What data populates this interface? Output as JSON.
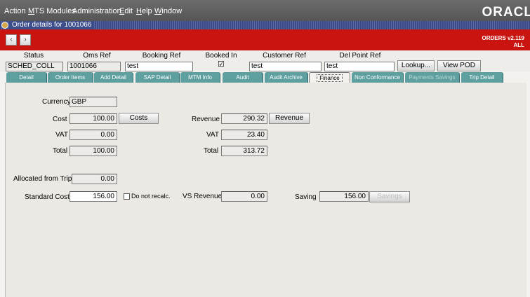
{
  "menu": {
    "items": [
      {
        "label": "Action"
      },
      {
        "label": "MTS Modules"
      },
      {
        "label": "Administration"
      },
      {
        "label": "Edit"
      },
      {
        "label": "Help"
      },
      {
        "label": "Window"
      }
    ],
    "logo": "ORACL"
  },
  "window": {
    "title": "Order details for 1001066"
  },
  "header": {
    "prev_icon": "‹",
    "next_icon": "›",
    "version_line1": "ORDERS v2.119",
    "version_line2": "ALL",
    "status": {
      "label": "Status",
      "value": "SCHED_COLL"
    },
    "oms_ref": {
      "label": "Oms Ref",
      "value": "1001066"
    },
    "booking_ref": {
      "label": "Booking Ref",
      "value": "test"
    },
    "booked_in": {
      "label": "Booked In",
      "checked": true
    },
    "customer_ref": {
      "label": "Customer Ref",
      "value": "test"
    },
    "del_point_ref": {
      "label": "Del Point Ref",
      "value": "test"
    },
    "lookup_label": "Lookup...",
    "view_pod_label": "View POD"
  },
  "tabs": [
    {
      "label": "Detail"
    },
    {
      "label": "Order Items"
    },
    {
      "label": "Add Detail"
    },
    {
      "label": "SAP Detail"
    },
    {
      "label": "MTM Info"
    },
    {
      "label": "Audit"
    },
    {
      "label": "Audit Archive"
    },
    {
      "label": "Finance"
    },
    {
      "label": "Non Conformance"
    },
    {
      "label": "Payments Savings"
    },
    {
      "label": "Trip Detail"
    }
  ],
  "finance": {
    "currency_label": "Currency",
    "currency_value": "GBP",
    "cost_label": "Cost",
    "cost_value": "100.00",
    "costs_button": "Costs",
    "vat_label": "VAT",
    "vat_value": "0.00",
    "total_label": "Total",
    "total_value": "100.00",
    "revenue_label": "Revenue",
    "revenue_value": "290.32",
    "revenue_button": "Revenue",
    "rev_vat_label": "VAT",
    "rev_vat_value": "23.40",
    "rev_total_label": "Total",
    "rev_total_value": "313.72",
    "allocated_label": "Allocated from Trip",
    "allocated_value": "0.00",
    "standard_cost_label": "Standard Cost",
    "standard_cost_value": "156.00",
    "do_not_recalc_label": "Do not recalc.",
    "vs_revenue_label": "VS Revenue",
    "vs_revenue_value": "0.00",
    "saving_label": "Saving",
    "saving_value": "156.00",
    "savings_button": "Savings"
  }
}
